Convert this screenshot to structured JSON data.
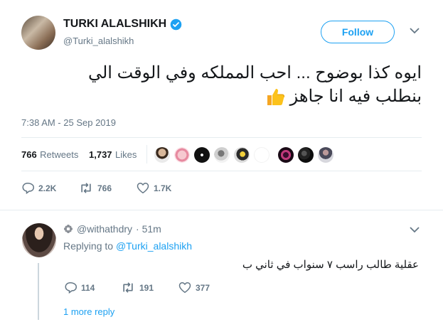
{
  "tweet": {
    "author_name": "TURKI ALALSHIKH",
    "author_handle": "@Turki_alalshikh",
    "follow_label": "Follow",
    "text_line1": "ايوه كذا بوضوح ... احب المملكه وفي الوقت الي",
    "text_line2": "بنطلب فيه انا جاهز",
    "emoji": "👍",
    "timestamp": "7:38 AM - 25 Sep 2019",
    "retweets_count": "766",
    "retweets_label": "Retweets",
    "likes_count": "1,737",
    "likes_label": "Likes",
    "actions": {
      "replies": "2.2K",
      "retweets": "766",
      "likes": "1.7K"
    }
  },
  "reply": {
    "handle": "@withathdry",
    "time": "· 51m",
    "replying_prefix": "Replying to",
    "replying_to": "@Turki_alalshikh",
    "text": "عقلية طالب راسب ٧ سنواب في ثاني ب",
    "actions": {
      "replies": "114",
      "retweets": "191",
      "likes": "377"
    },
    "more_replies": "1 more reply"
  },
  "colors": {
    "accent": "#1da1f2",
    "muted": "#657786",
    "divider": "#e6ecf0",
    "verified": "#1da1f2"
  },
  "icons": [
    "verified-badge-icon",
    "chevron-down-icon",
    "reply-icon",
    "retweet-icon",
    "like-icon",
    "thumbs-up-emoji",
    "flower-emoji"
  ]
}
